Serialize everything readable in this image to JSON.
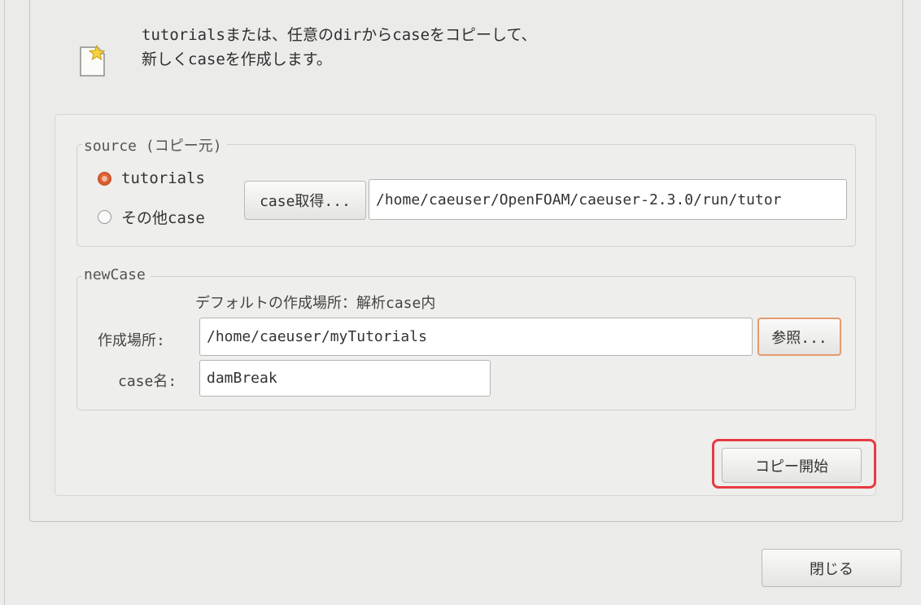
{
  "header": {
    "description": "tutorialsまたは、任意のdirからcaseをコピーして、\n新しくcaseを作成します。",
    "icon": "new-document-star-icon"
  },
  "source": {
    "title": "source (コピー元)",
    "radios": [
      {
        "label": "tutorials",
        "checked": true
      },
      {
        "label": "その他case",
        "checked": false
      }
    ],
    "fetch_button": "case取得...",
    "path_value": "/home/caeuser/OpenFOAM/caeuser-2.3.0/run/tutor"
  },
  "new_case": {
    "title": "newCase",
    "default_location_note": "デフォルトの作成場所：解析case内",
    "location_label": "作成場所:",
    "location_value": "/home/caeuser/myTutorials",
    "browse_button": "参照...",
    "name_label": "case名:",
    "name_value": "damBreak"
  },
  "actions": {
    "start_copy": "コピー開始",
    "close": "閉じる"
  },
  "colors": {
    "accent": "#d85a30",
    "highlight": "#e63b43",
    "focus": "#e69a6f"
  }
}
